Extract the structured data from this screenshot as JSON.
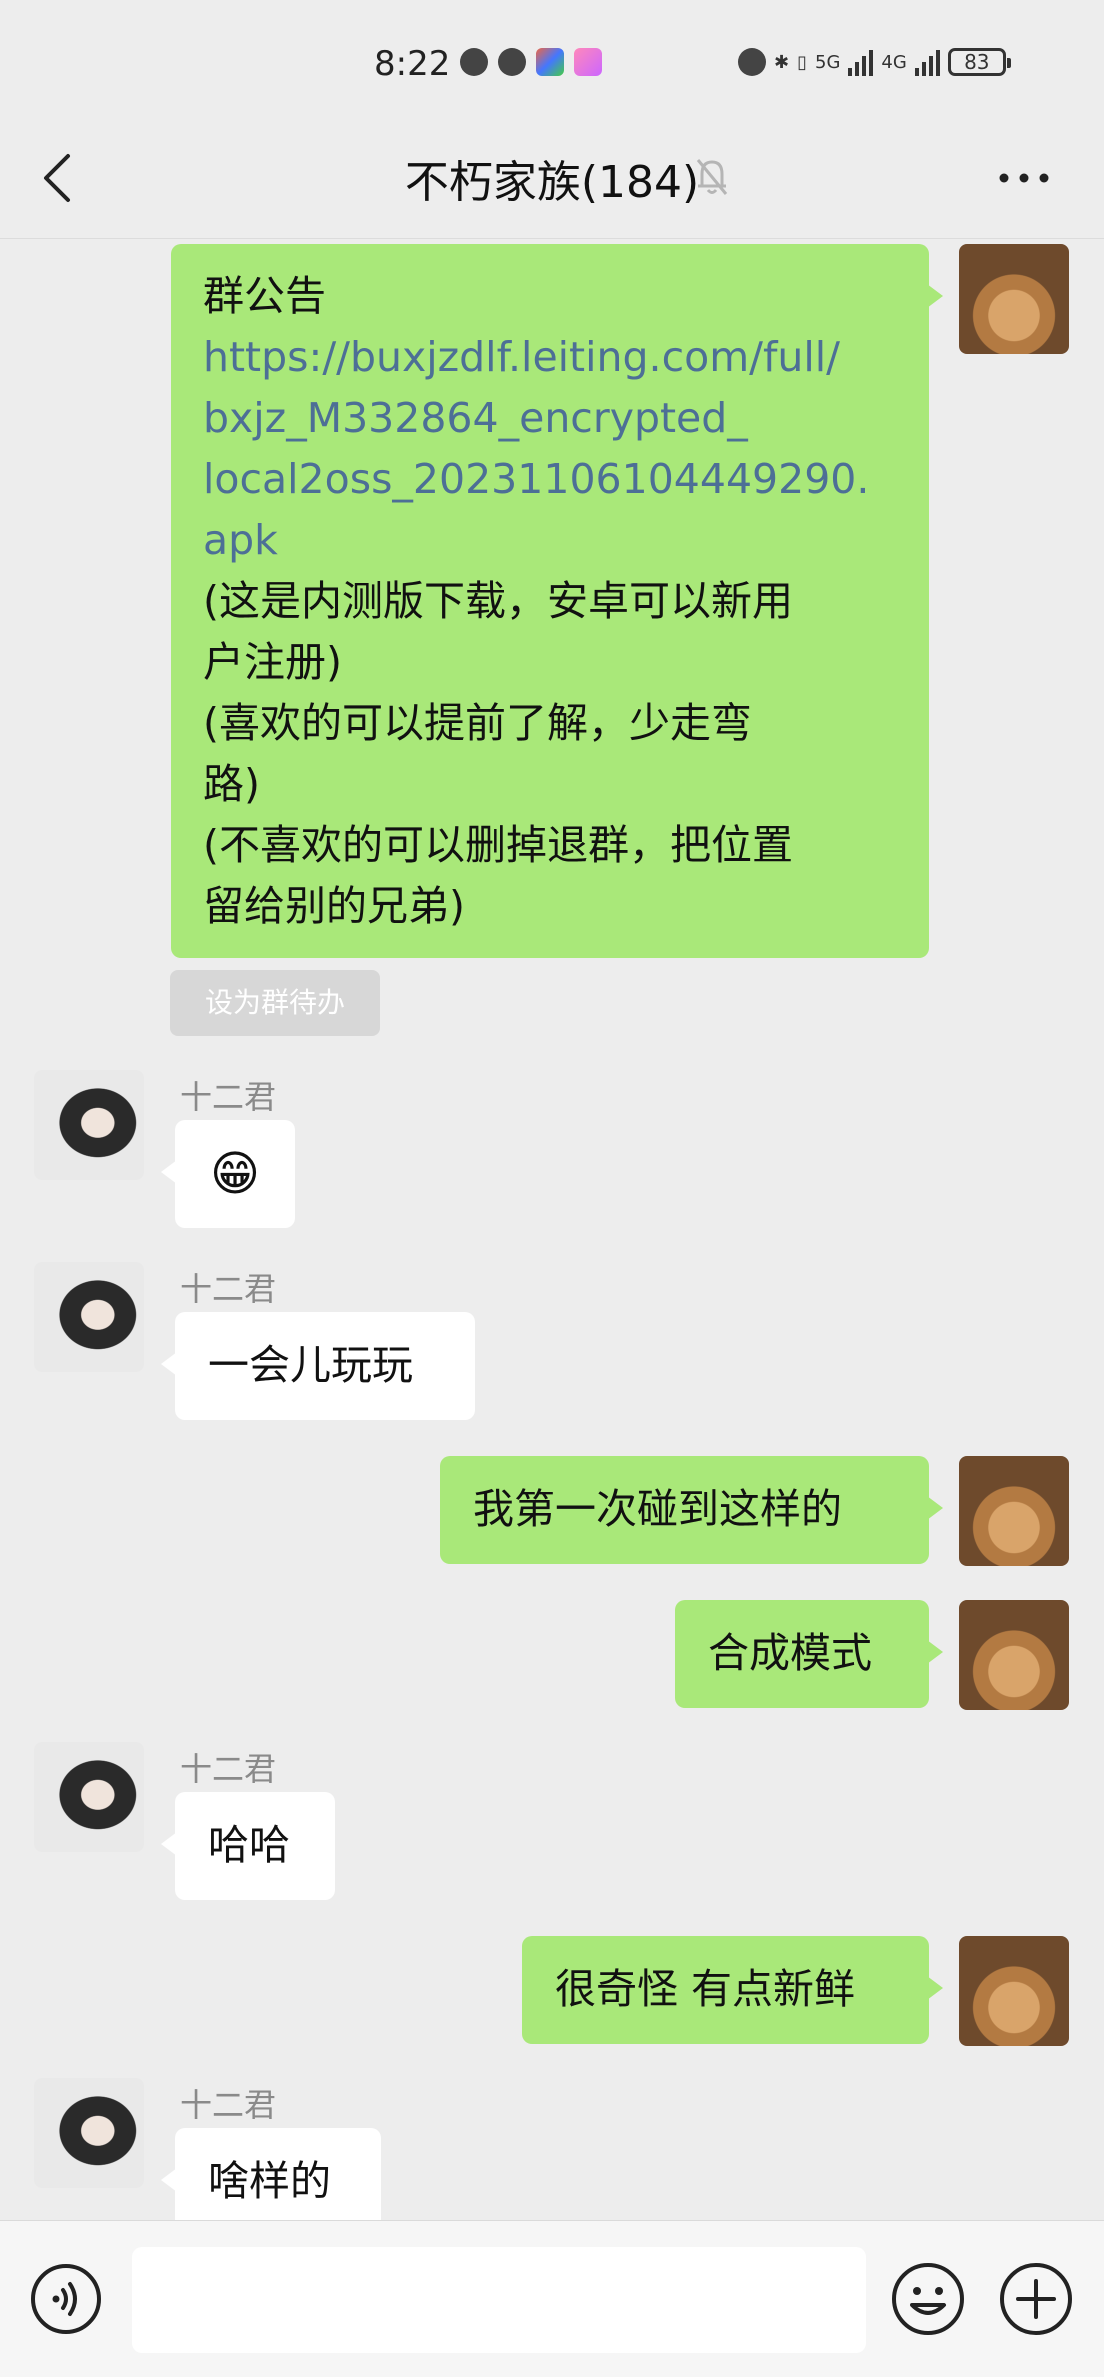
{
  "status_bar": {
    "time": "8:22",
    "battery": "83",
    "net_5g": "5G",
    "net_4g": "4G"
  },
  "nav": {
    "title": "不朽家族(184)"
  },
  "messages": [
    {
      "side": "right",
      "type": "announcement",
      "heading": "群公告",
      "link_lines": [
        "https://buxjzdlf.leiting.com/full/",
        "bxjz_M332864_encrypted_",
        "local2oss_20231106104449290.",
        "apk"
      ],
      "text_lines": [
        "(这是内测版下载，安卓可以新用",
        "户注册)",
        "(喜欢的可以提前了解，少走弯",
        "路)",
        "(不喜欢的可以删掉退群，把位置",
        "留给别的兄弟)"
      ],
      "action": "设为群待办"
    },
    {
      "side": "left",
      "sender": "十二君",
      "emoji": "😁"
    },
    {
      "side": "left",
      "sender": "十二君",
      "text": "一会儿玩玩"
    },
    {
      "side": "right",
      "text": "我第一次碰到这样的"
    },
    {
      "side": "right",
      "text": "合成模式"
    },
    {
      "side": "left",
      "sender": "十二君",
      "text": "哈哈"
    },
    {
      "side": "right",
      "text": "很奇怪 有点新鲜"
    },
    {
      "side": "left",
      "sender": "十二君",
      "text": "啥样的"
    }
  ],
  "colors": {
    "background": "#ededed",
    "bubble_self": "#a9e879",
    "bubble_other": "#ffffff",
    "link": "#4d6f96"
  }
}
